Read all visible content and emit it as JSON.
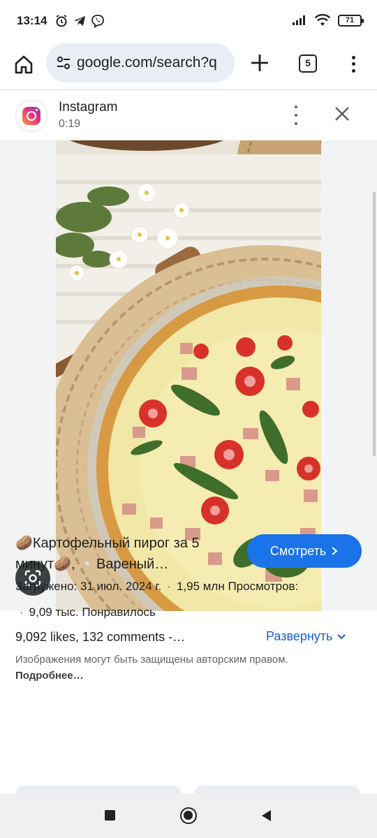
{
  "status_bar": {
    "time": "13:14",
    "left_icons": [
      "alarm-icon",
      "telegram-icon",
      "viber-icon"
    ],
    "right_icons": [
      "signal-icon",
      "wifi-icon",
      "battery-icon"
    ],
    "battery": "71"
  },
  "browser": {
    "url": "google.com/search?q",
    "tab_count": "5"
  },
  "source": {
    "name": "Instagram",
    "duration": "0:19"
  },
  "result": {
    "title": "🥔Картофельный пирог за 5 минут🥔, ▫️Вареный…",
    "watch_label": "Смотреть",
    "uploaded": "Загружено: 31 июл. 2024 г.",
    "views": "1,95 млн Просмотров:",
    "likes_short": "9,09 тыс. Понравилось",
    "likes_comments": "9,092 likes, 132 comments -…",
    "expand_label": "Развернуть",
    "copyright_text": "Изображения могут быть защищены авторским правом.",
    "more_link": "Подробнее…"
  },
  "colors": {
    "accent": "#1a73e8",
    "link": "#1a5fc9",
    "url_pill": "#e9eef6",
    "muted_text": "#5f6368"
  }
}
